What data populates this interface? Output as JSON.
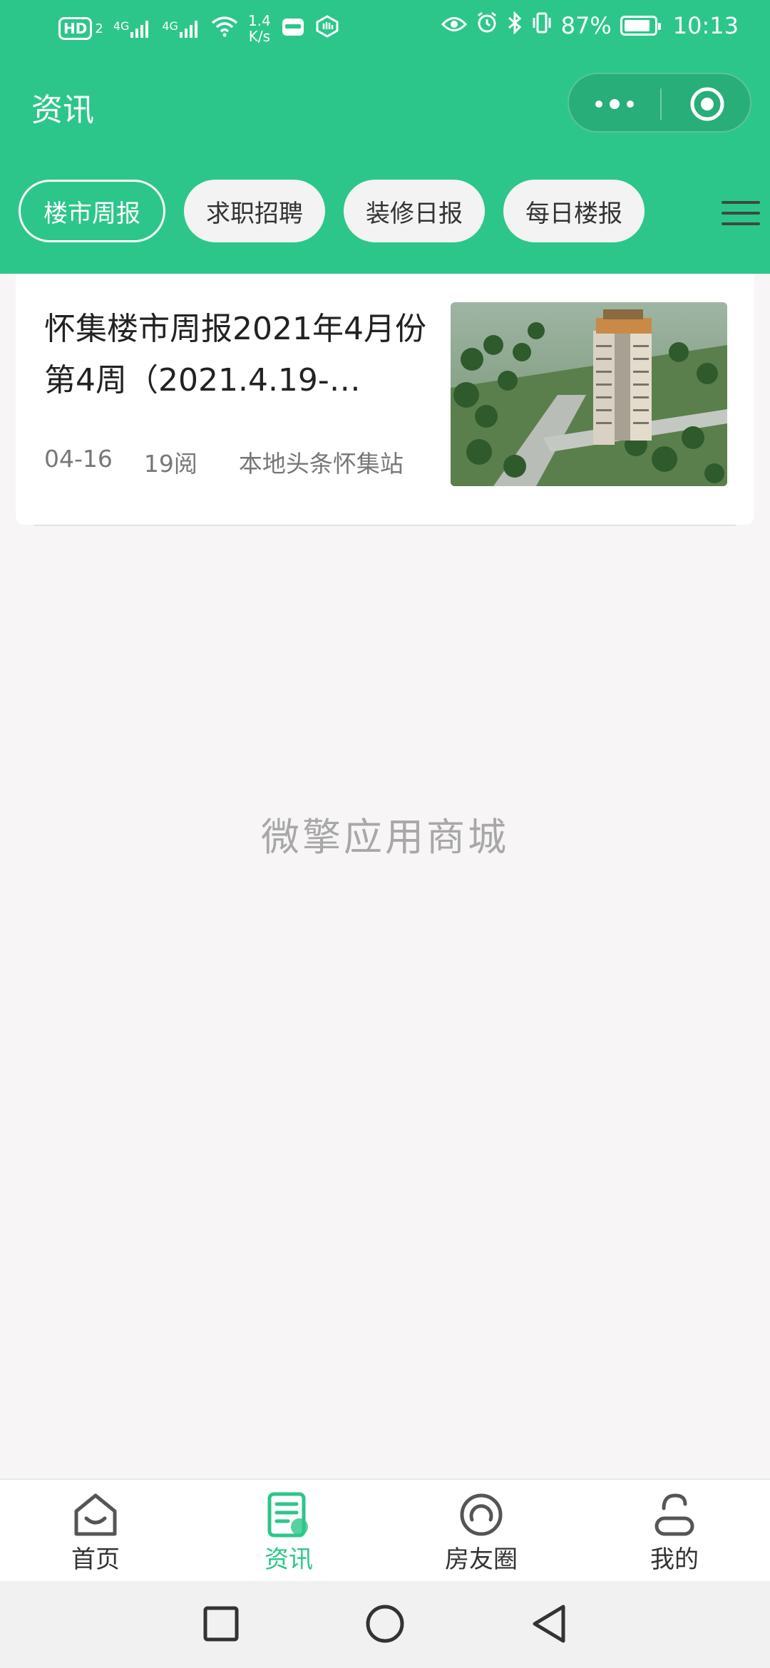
{
  "status_bar": {
    "hd_badge": "HD",
    "hd_sub": "2",
    "net1": "4G",
    "net2": "4G",
    "speed_value": "1.4",
    "speed_unit": "K/s",
    "battery": "87%",
    "battery_level": 0.87,
    "time": "10:13"
  },
  "header": {
    "title": "资讯",
    "capsule_more": "more-dots-icon",
    "capsule_close": "target-close-icon",
    "color": "#2dc68a"
  },
  "tabs": [
    {
      "label": "楼市周报",
      "active": true
    },
    {
      "label": "求职招聘",
      "active": false
    },
    {
      "label": "装修日报",
      "active": false
    },
    {
      "label": "每日楼报",
      "active": false
    }
  ],
  "articles": [
    {
      "title": "怀集楼市周报2021年4月份第4周（2021.4.19-…",
      "date": "04-16",
      "reads": "19阅",
      "source": "本地头条怀集站",
      "thumbnail": "building-rendering-image"
    }
  ],
  "watermark": "微擎应用商城",
  "tabbar": [
    {
      "label": "首页",
      "icon": "home-icon",
      "active": false
    },
    {
      "label": "资讯",
      "icon": "news-icon",
      "active": true
    },
    {
      "label": "房友圈",
      "icon": "circle-icon",
      "active": false
    },
    {
      "label": "我的",
      "icon": "profile-icon",
      "active": false
    }
  ],
  "system_nav": [
    "recent-apps-icon",
    "home-circle-icon",
    "back-triangle-icon"
  ]
}
